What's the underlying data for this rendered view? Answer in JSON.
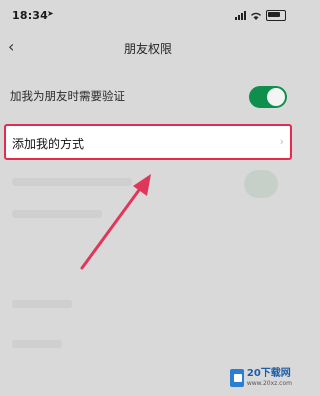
{
  "status_bar": {
    "time": "18:34",
    "location_icon": "location-arrow-icon",
    "signal_icon": "cellular-signal-icon",
    "wifi_icon": "wifi-icon",
    "battery_icon": "battery-icon"
  },
  "nav": {
    "back_icon": "chevron-left-icon",
    "back_glyph": "‹",
    "title": "朋友权限"
  },
  "settings": {
    "verify_label": "加我为朋友时需要验证",
    "verify_enabled": true,
    "add_me_label": "添加我的方式",
    "add_me_chevron": "›"
  },
  "colors": {
    "toggle_on": "#0f8f4e",
    "highlight_border": "#e62a4d",
    "arrow": "#e0365a"
  },
  "watermark": {
    "main": "20下载网",
    "sub": "www.20xz.com"
  }
}
